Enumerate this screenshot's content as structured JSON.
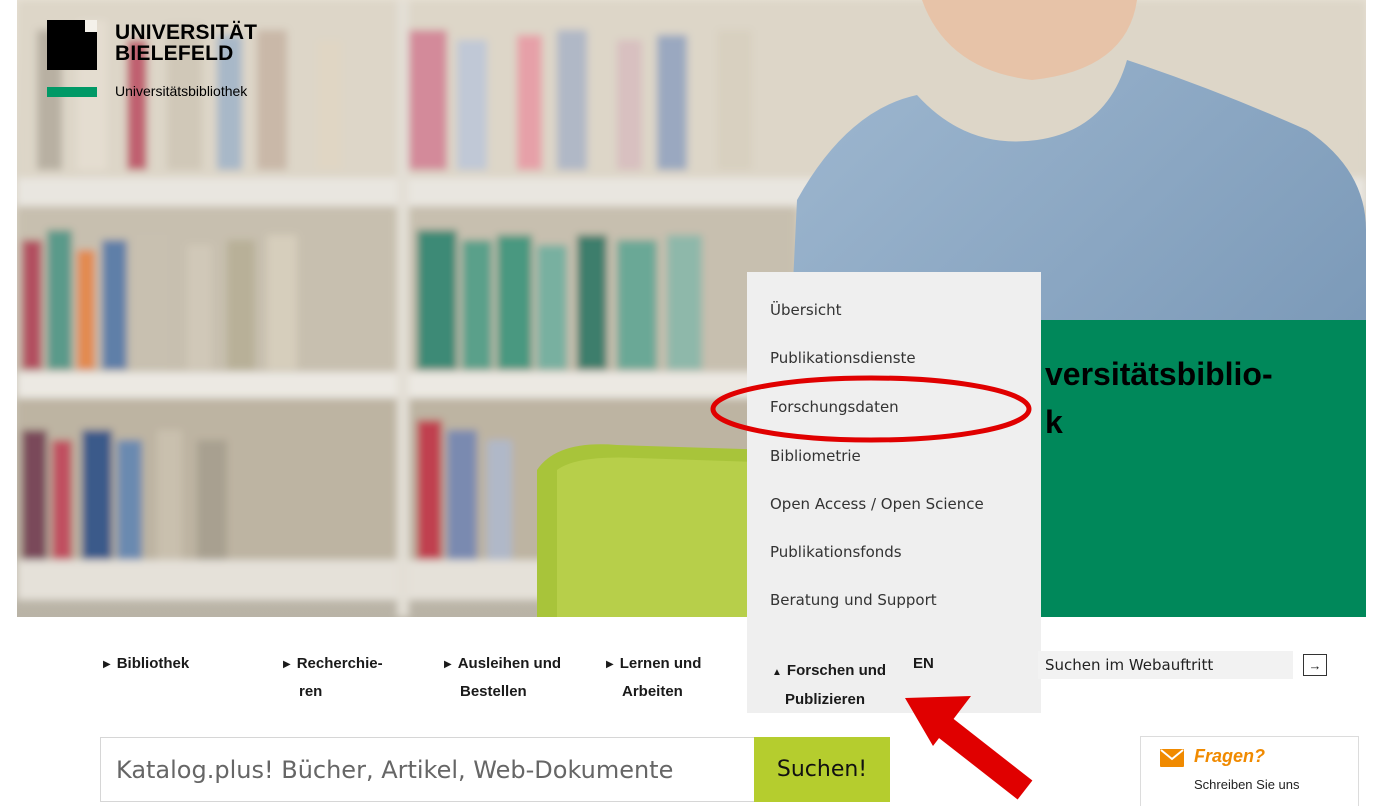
{
  "brand": {
    "line1": "UNIVERSITÄT",
    "line2": "BIELEFELD",
    "subtitle": "Universitätsbibliothek",
    "colors": {
      "black": "#000000",
      "green": "#009966"
    }
  },
  "hero": {
    "title_line1": "versitätsbiblio-",
    "title_line2": "k",
    "box_color": "#00885a"
  },
  "nav": {
    "items": [
      {
        "line1": "Bibliothek",
        "line2": ""
      },
      {
        "line1": "Recherchie-",
        "line2": "ren"
      },
      {
        "line1": "Ausleihen und",
        "line2": "Bestellen"
      },
      {
        "line1": "Lernen und",
        "line2": "Arbeiten"
      }
    ],
    "active": {
      "line1": "Forschen und",
      "line2": "Publizieren"
    },
    "language": "EN",
    "search_placeholder": "Suchen im Webauftritt"
  },
  "dropdown": {
    "items": [
      "Übersicht",
      "Publikationsdienste",
      "Forschungsdaten",
      "Bibliometrie",
      "Open Access / Open Science",
      "Publikationsfonds",
      "Beratung und Support"
    ],
    "highlighted": "Forschungsdaten"
  },
  "catalog": {
    "placeholder": "Katalog.plus! Bücher, Artikel, Web-Dokumente",
    "button": "Suchen!",
    "button_color": "#b5cd2e"
  },
  "fragen": {
    "title": "Fragen?",
    "subtitle": "Schreiben Sie uns",
    "accent": "#f08a00"
  },
  "annotations": {
    "color": "#e00000"
  }
}
